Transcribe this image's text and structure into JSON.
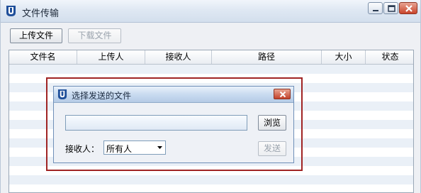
{
  "window": {
    "title": "文件传输"
  },
  "toolbar": {
    "upload_label": "上传文件",
    "download_label": "下载文件"
  },
  "table": {
    "columns": [
      "文件名",
      "上传人",
      "接收人",
      "路径",
      "大小",
      "状态"
    ],
    "rows": []
  },
  "dialog": {
    "title": "选择发送的文件",
    "path_value": "",
    "browse_label": "浏览",
    "recipient_label": "接收人：",
    "recipient_selected": "所有人",
    "send_label": "发送"
  },
  "colors": {
    "highlight_border": "#a02424",
    "title_bar": "#dfe8f3",
    "row_stripe": "#eaf0f7"
  }
}
